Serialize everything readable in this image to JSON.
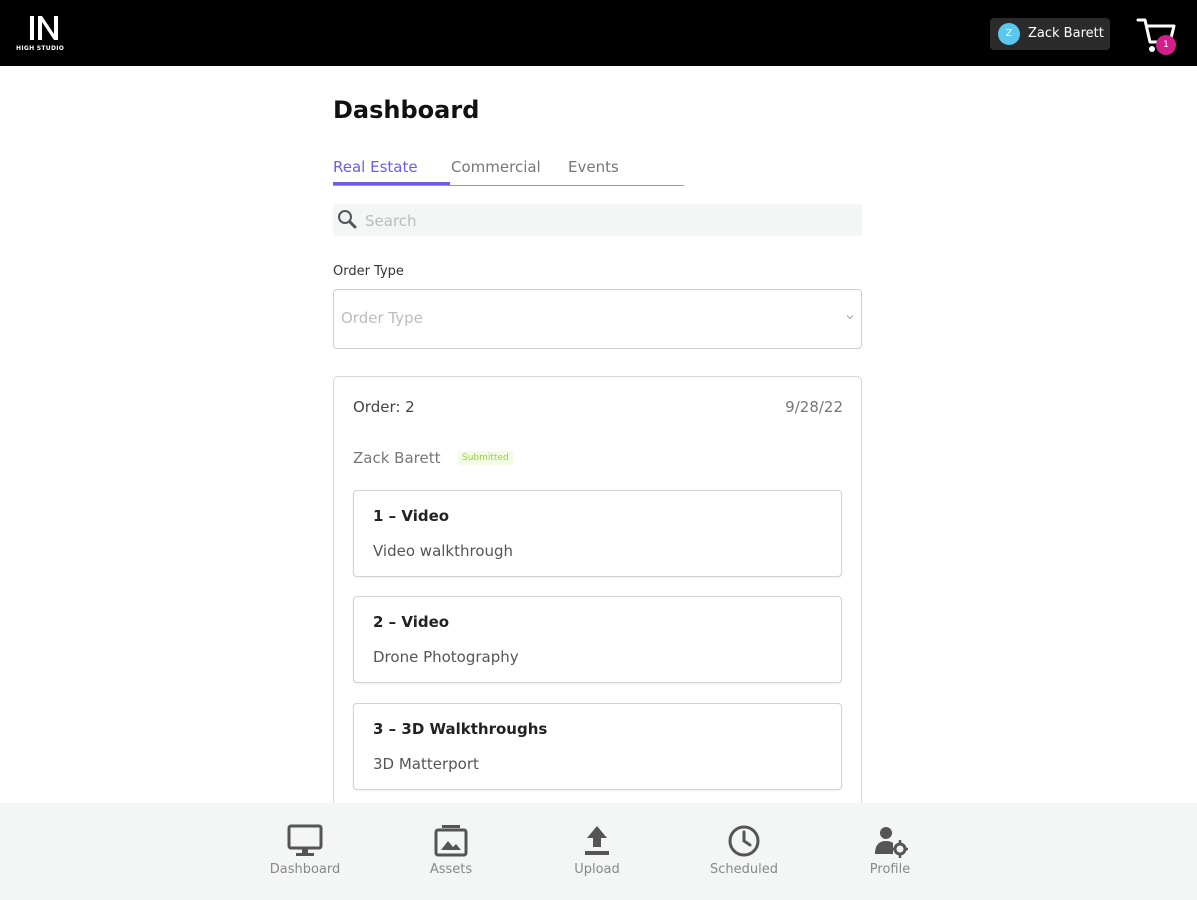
{
  "header": {
    "logo_text": "HIGH STUDIO",
    "user": {
      "avatar_initial": "Z",
      "name": "Zack Barett"
    },
    "cart_count": "1"
  },
  "page": {
    "title": "Dashboard"
  },
  "tabs": [
    {
      "label": "Real Estate",
      "active": true
    },
    {
      "label": "Commercial",
      "active": false
    },
    {
      "label": "Events",
      "active": false
    }
  ],
  "search": {
    "placeholder": "Search",
    "value": ""
  },
  "filter": {
    "label": "Order Type",
    "placeholder": "Order Type"
  },
  "order": {
    "number": "Order: 2",
    "date": "9/28/22",
    "customer": "Zack Barett",
    "status": "Submitted",
    "items": [
      {
        "title": "1 – Video",
        "description": "Video walkthrough"
      },
      {
        "title": "2 – Video",
        "description": "Drone Photography"
      },
      {
        "title": "3 – 3D Walkthroughs",
        "description": "3D Matterport"
      }
    ]
  },
  "bottom_nav": [
    {
      "label": "Dashboard",
      "icon": "monitor-icon"
    },
    {
      "label": "Assets",
      "icon": "image-icon"
    },
    {
      "label": "Upload",
      "icon": "upload-icon"
    },
    {
      "label": "Scheduled",
      "icon": "clock-icon"
    },
    {
      "label": "Profile",
      "icon": "user-gear-icon"
    }
  ],
  "colors": {
    "accent": "#6d5ce8",
    "avatar": "#5bc7ef",
    "badge": "#d21f8c",
    "status_text": "#9ccf40"
  }
}
